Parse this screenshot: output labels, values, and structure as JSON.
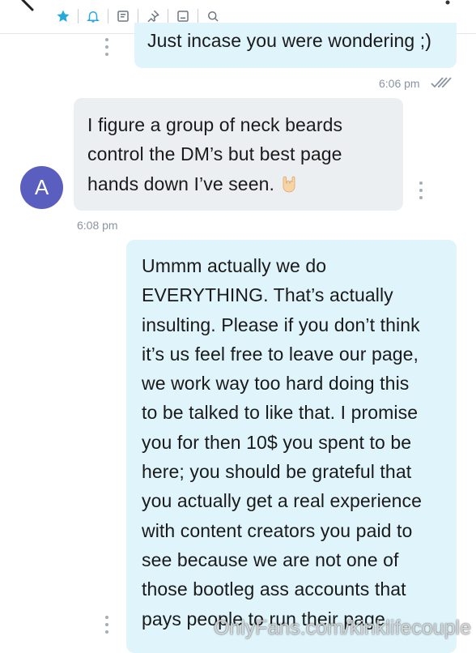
{
  "toolbar": {
    "icons": [
      "back-arrow-icon",
      "star-icon",
      "bell-icon",
      "note-icon",
      "pin-icon",
      "image-icon",
      "search-icon",
      "more-icon"
    ],
    "accent": "#29a8e0"
  },
  "messages": [
    {
      "direction": "outgoing",
      "text": "Just incase you were wondering ;)",
      "time": "6:06 pm",
      "status": "read"
    },
    {
      "direction": "incoming",
      "text": "I figure a group of neck beards\ncontrol the DM’s but best page\nhands down I’ve seen.",
      "emoji": "rock-on-hand",
      "time": "6:08 pm",
      "avatar_initial": "A"
    },
    {
      "direction": "outgoing",
      "text": "Ummm actually we do\nEVERYTHING. That’s actually\ninsulting. Please if you don’t think\nit’s us feel free to leave our page,\nwe work way too hard doing this\nto be talked to like that. I promise\nyou for then 10$ you spent to be\nhere; you should be grateful that\nyou actually get a real experience\nwith content creators you paid to\nsee because we are not one of\nthose bootleg ass accounts that\npays people to run their page."
    }
  ],
  "colors": {
    "outgoing_bubble": "#dff4fb",
    "incoming_bubble": "#eceff2",
    "avatar": "#5a5fbf",
    "timestamp": "#8a94a0"
  },
  "watermark": "OnlyFans.com/kinklifecouple"
}
